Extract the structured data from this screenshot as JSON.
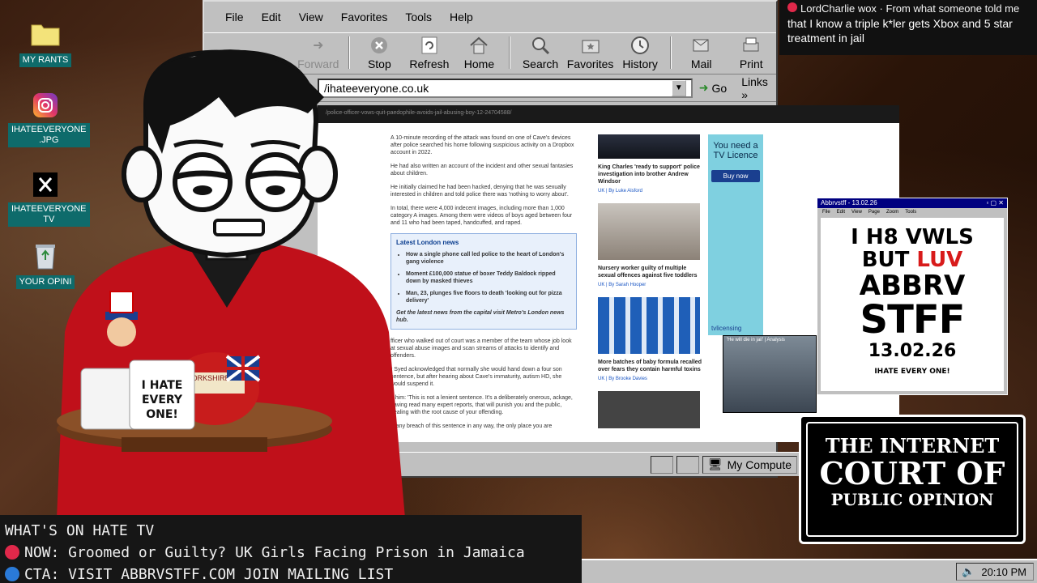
{
  "desktop": {
    "icons": [
      {
        "label": "MY RANTS",
        "icon": "folder-icon"
      },
      {
        "label": "IHATEEVERYONE\n.JPG",
        "icon": "instagram-icon"
      },
      {
        "label": "IHATEEVERYONE\nTV",
        "icon": "x-icon"
      },
      {
        "label": "YOUR OPINI",
        "icon": "recycle-bin-icon"
      }
    ]
  },
  "browser": {
    "menu": [
      "File",
      "Edit",
      "View",
      "Favorites",
      "Tools",
      "Help"
    ],
    "toolbar": [
      "Forward",
      "Stop",
      "Refresh",
      "Home",
      "Search",
      "Favorites",
      "History",
      "Mail",
      "Print"
    ],
    "address": "/ihateeveryone.co.uk",
    "go_label": "Go",
    "links_label": "Links",
    "status_zone": "My Compute"
  },
  "article": {
    "url": "/police-officer-vows-quit-paedophile-avoids-jail-abusing-boy-12-24704588/",
    "paragraphs": [
      "A 10-minute recording of the attack was found on one of Cave's devices after police searched his home following suspicious activity on a Dropbox account in 2022.",
      "He had also written an account of the incident and other sexual fantasies about children.",
      "He initially claimed he had been hacked, denying that he was sexually interested in children and told police there was 'nothing to worry about'.",
      "In total, there were 4,000 indecent images, including more than 1,000 category A images. Among them were videos of boys aged between four and 11 who had been taped, handcuffed, and raped."
    ],
    "london_box": {
      "title": "Latest London news",
      "items": [
        "How a single phone call led police to the heart of London's gang violence",
        "Moment £100,000 statue of boxer Teddy Baldock ripped down by masked thieves",
        "Man, 23, plunges five floors to death 'looking out for pizza delivery'"
      ],
      "footer": "Get the latest news from the capital visit Metro's London news hub."
    },
    "paragraphs_after": [
      "fficer who walked out of court was a member of the team whose job look at sexual abuse images and scan streams of attacks to identify and offenders.",
      "r Syed acknowledged that normally she would hand down a four son sentence, but after hearing about Cave's immaturity, autism HD, she would suspend it.",
      "d him: 'This is not a lenient sentence. It's a deliberately onerous, ackage, having read many expert reports, that will punish you and the public, dealing with the root cause of your offending.",
      "'s any breach of this sentence in any way, the only place you are"
    ],
    "sidebar": [
      {
        "title": "King Charles 'ready to support' police investigation into brother Andrew Windsor",
        "tag": "UK",
        "author": "By Luke Alsford"
      },
      {
        "title": "Nursery worker guilty of multiple sexual offences against five toddlers",
        "tag": "UK",
        "author": "By Sarah Hooper"
      },
      {
        "title": "More batches of baby formula recalled over fears they contain harmful toxins",
        "tag": "UK",
        "author": "By Brooke Davies"
      }
    ],
    "ad": {
      "text": "You need a TV Licence",
      "button": "Buy now",
      "brand": "tvlicensing"
    },
    "video_caption": "'He will die in jail' | Analysis"
  },
  "chat": {
    "name": "LordCharlie wox",
    "message_partial": "From what someone told me",
    "message": "that I know a triple k*ler gets Xbox and 5 star treatment in jail"
  },
  "promo": {
    "title_bar": "Abbrvstff - 13.02.26",
    "menu": [
      "File",
      "Edit",
      "View",
      "Page",
      "Zoom",
      "Tools"
    ],
    "line1": "I H8 VWLS",
    "line2a": "BUT ",
    "line2b": "LUV",
    "line3": "ABBRV",
    "line4": "STFF",
    "date": "13.02.26",
    "logo": "IHATE EVERY ONE!"
  },
  "court": {
    "line1": "THE INTERNET",
    "line2": "COURT OF",
    "line3": "PUBLIC OPINION"
  },
  "ticker": {
    "heading": "WHAT'S ON HATE TV",
    "now": "NOW: Groomed or Guilty? UK Girls Facing Prison in Jamaica",
    "cta": "CTA: VISIT ABBRVSTFF.COM JOIN MAILING LIST",
    "now_color": "#e0284a",
    "cta_color": "#2a7ad8"
  },
  "taskbar": {
    "time": "20:10 PM"
  },
  "mug_text": [
    "I HATE",
    "EVERY",
    "ONE!"
  ],
  "tea_text": "YORKSHIRE TEA"
}
